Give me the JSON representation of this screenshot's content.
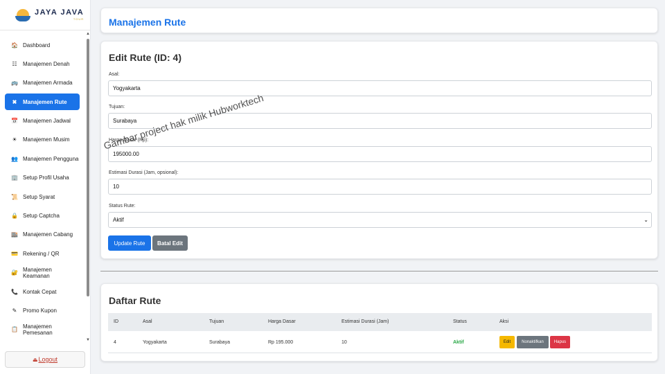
{
  "brand": {
    "name": "JAYA JAVA",
    "sub": "TOUR"
  },
  "sidebar": {
    "items": [
      {
        "label": "Dashboard",
        "icon": "🏠",
        "icon_name": "home-icon"
      },
      {
        "label": "Manajemen Denah",
        "icon": "☷",
        "icon_name": "grid-icon"
      },
      {
        "label": "Manajemen Armada",
        "icon": "🚌",
        "icon_name": "bus-icon"
      },
      {
        "label": "Manajemen Rute",
        "icon": "✖",
        "icon_name": "tools-icon"
      },
      {
        "label": "Manajemen Jadwal",
        "icon": "📅",
        "icon_name": "calendar-icon"
      },
      {
        "label": "Manajemen Musim",
        "icon": "☀",
        "icon_name": "season-icon"
      },
      {
        "label": "Manajemen Pengguna",
        "icon": "👥",
        "icon_name": "users-icon"
      },
      {
        "label": "Setup Profil Usaha",
        "icon": "🏢",
        "icon_name": "building-icon"
      },
      {
        "label": "Setup Syarat",
        "icon": "📜",
        "icon_name": "scroll-icon"
      },
      {
        "label": "Setup Captcha",
        "icon": "🔒",
        "icon_name": "lock-icon"
      },
      {
        "label": "Manajemen Cabang",
        "icon": "🏬",
        "icon_name": "branch-icon"
      },
      {
        "label": "Rekening / QR",
        "icon": "💳",
        "icon_name": "card-icon"
      },
      {
        "label": "Manajemen Keamanan",
        "icon": "🔐",
        "icon_name": "security-icon"
      },
      {
        "label": "Kontak Cepat",
        "icon": "📞",
        "icon_name": "phone-icon"
      },
      {
        "label": "Promo Kupon",
        "icon": "✎",
        "icon_name": "coupon-icon"
      },
      {
        "label": "Manajemen Pemesanan",
        "icon": "📋",
        "icon_name": "clipboard-icon"
      }
    ],
    "active_index": 3,
    "logout_label": "Logout"
  },
  "header": {
    "title": "Manajemen Rute"
  },
  "edit_form": {
    "title": "Edit Rute (ID: 4)",
    "asal_label": "Asal:",
    "asal_value": "Yogyakarta",
    "tujuan_label": "Tujuan:",
    "tujuan_value": "Surabaya",
    "harga_label": "Harga Dasar (Rp):",
    "harga_value": "195000.00",
    "estimasi_label": "Estimasi Durasi (Jam, opsional):",
    "estimasi_value": "10",
    "status_label": "Status Rute:",
    "status_value": "Aktif",
    "update_label": "Update Rute",
    "cancel_label": "Batal Edit"
  },
  "list": {
    "title": "Daftar Rute",
    "columns": [
      "ID",
      "Asal",
      "Tujuan",
      "Harga Dasar",
      "Estimasi Durasi (Jam)",
      "Status",
      "Aksi"
    ],
    "rows": [
      {
        "id": "4",
        "asal": "Yogyakarta",
        "tujuan": "Surabaya",
        "harga": "Rp 195.000",
        "estimasi": "10",
        "status": "Aktif"
      }
    ],
    "actions": {
      "edit": "Edit",
      "nonaktif": "Nonaktifkan",
      "hapus": "Hapus"
    }
  },
  "watermark": "Gambar project hak milik Hubworktech"
}
